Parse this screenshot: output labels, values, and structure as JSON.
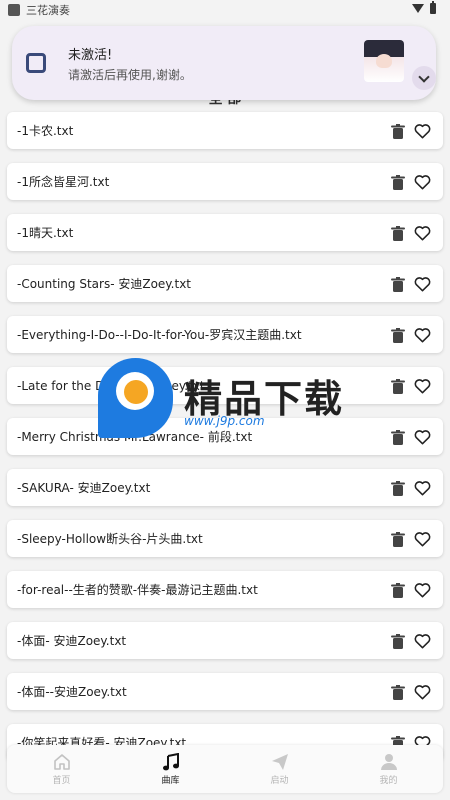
{
  "status_bar": {
    "app_name": "三花演奏"
  },
  "notification": {
    "title": "未激活!",
    "body": "请激活后再使用,谢谢。"
  },
  "section_title": "全 部",
  "files": [
    "-1卡农.txt",
    "-1所念皆星河.txt",
    "-1晴天.txt",
    "-Counting Stars- 安迪Zoey.txt",
    "-Everything-I-Do--I-Do-It-for-You-罗宾汉主题曲.txt",
    "-Late for the Date- 安迪Zoey.txt",
    "-Merry Christmas Mr.Lawrance- 前段.txt",
    "-SAKURA- 安迪Zoey.txt",
    "-Sleepy-Hollow断头谷-片头曲.txt",
    "-for-real--生者的赞歌-伴奏-最游记主题曲.txt",
    "-体面- 安迪Zoey.txt",
    "-体面--安迪Zoey.txt",
    "-你笑起来真好看- 安迪Zoey.txt"
  ],
  "watermark": {
    "text": "精品下载",
    "url": "www.j9p.com"
  },
  "tabs": [
    {
      "label": "首页",
      "icon": "home-icon",
      "active": false
    },
    {
      "label": "曲库",
      "icon": "music-note-icon",
      "active": true
    },
    {
      "label": "启动",
      "icon": "send-icon",
      "active": false
    },
    {
      "label": "我的",
      "icon": "user-icon",
      "active": false
    }
  ],
  "colors": {
    "accent": "#1e7be0",
    "notification_bg": "#f1ecf7"
  }
}
